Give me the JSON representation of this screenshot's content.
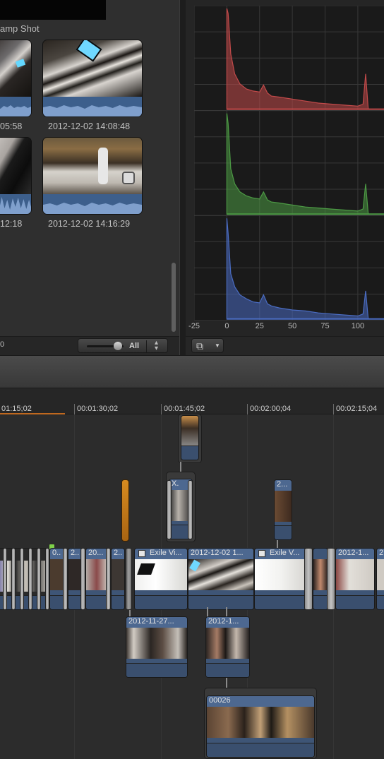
{
  "browser": {
    "event_name": "amp Shot",
    "counter": "0",
    "filter_label": "All",
    "clips": [
      {
        "label": "05:58"
      },
      {
        "label": "2012-12-02 14:08:48"
      },
      {
        "label": "12:18"
      },
      {
        "label": "2012-12-02 14:16:29"
      }
    ]
  },
  "scopes": {
    "type": "RGB Parade histogram",
    "x_ticks": [
      "-25",
      "0",
      "25",
      "50",
      "75",
      "100"
    ],
    "channel_colors": [
      "#c24a4a",
      "#4c9a44",
      "#4a6cc2"
    ]
  },
  "chart_data": {
    "type": "area",
    "x_ticks": [
      -25,
      0,
      25,
      50,
      75,
      100
    ],
    "xlim": [
      -25,
      120
    ],
    "grid": true,
    "series": [
      {
        "color": "#c24a4a",
        "x": [
          0,
          1,
          3,
          6,
          10,
          15,
          20,
          25,
          28,
          31,
          34,
          40,
          50,
          60,
          70,
          80,
          90,
          100,
          104,
          106,
          108
        ],
        "y": [
          1.0,
          0.95,
          0.55,
          0.35,
          0.25,
          0.2,
          0.18,
          0.17,
          0.24,
          0.16,
          0.13,
          0.12,
          0.1,
          0.08,
          0.06,
          0.05,
          0.04,
          0.03,
          0.05,
          0.35,
          0.0
        ]
      },
      {
        "color": "#4c9a44",
        "x": [
          0,
          1,
          3,
          6,
          10,
          15,
          20,
          25,
          28,
          31,
          34,
          40,
          50,
          60,
          70,
          80,
          90,
          100,
          104,
          106,
          108
        ],
        "y": [
          1.0,
          0.9,
          0.45,
          0.3,
          0.22,
          0.18,
          0.16,
          0.15,
          0.22,
          0.14,
          0.12,
          0.11,
          0.09,
          0.07,
          0.06,
          0.05,
          0.04,
          0.03,
          0.05,
          0.3,
          0.0
        ]
      },
      {
        "color": "#4a6cc2",
        "x": [
          0,
          1,
          3,
          6,
          10,
          15,
          20,
          25,
          28,
          31,
          34,
          40,
          50,
          60,
          70,
          80,
          90,
          100,
          104,
          106,
          108
        ],
        "y": [
          1.0,
          0.85,
          0.45,
          0.32,
          0.24,
          0.2,
          0.17,
          0.16,
          0.24,
          0.15,
          0.13,
          0.11,
          0.09,
          0.08,
          0.06,
          0.05,
          0.04,
          0.03,
          0.05,
          0.28,
          0.0
        ]
      }
    ]
  },
  "timeline": {
    "timecodes": [
      "01:15;02",
      "00:01:30;02",
      "00:01:45;02",
      "00:02:00;04",
      "00:02:15;04"
    ],
    "clips": [
      {
        "title": "0.."
      },
      {
        "title": "2.."
      },
      {
        "title": "20..."
      },
      {
        "title": "2.."
      },
      {
        "title": "Exile Vi..."
      },
      {
        "title": "2012-12-02 1..."
      },
      {
        "title": "Exile V..."
      },
      {
        "title": "2012-1..."
      },
      {
        "title": "2"
      }
    ],
    "connected": [
      {
        "title": "X."
      },
      {
        "title": "2..."
      },
      {
        "title": "2012-11-27..."
      },
      {
        "title": "2012-1..."
      },
      {
        "title": "00026"
      }
    ]
  }
}
